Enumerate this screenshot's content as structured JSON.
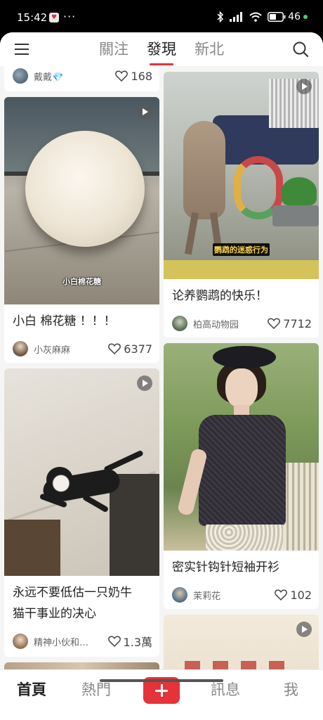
{
  "status_bar": {
    "time": "15:42",
    "dots": "···",
    "battery": "46",
    "app_badge": "♥"
  },
  "top_nav": {
    "tabs": [
      "關注",
      "發現",
      "新北"
    ],
    "active_tab": "發現"
  },
  "feed": {
    "left": [
      {
        "title": "",
        "author": "戴戴💎",
        "likes": "168"
      },
      {
        "title": "小白 棉花糖 ！！！",
        "image_caption": "小白棉花糖",
        "author": "小灰麻麻",
        "likes": "6377",
        "is_video": true
      },
      {
        "title_line1": "永远不要低估一只奶牛",
        "title_line2": "猫干事业的决心",
        "author": "精神小伙和…",
        "likes": "1.3萬",
        "is_video": true
      }
    ],
    "right": [
      {
        "title": "论养鹦鹉的快乐！",
        "image_caption": "鹦鹉的迷惑行为",
        "author": "柏高动物园",
        "likes": "7712",
        "is_video": true
      },
      {
        "title": "密实针钩针短袖开衫",
        "author": "茉莉花",
        "likes": "102"
      },
      {
        "title": "",
        "author": "",
        "likes": "",
        "is_video": true
      }
    ]
  },
  "bottom_nav": {
    "items": [
      "首頁",
      "熱門",
      "訊息",
      "我"
    ],
    "active": "首頁"
  },
  "colors": {
    "accent": "#e5333a",
    "background": "#f5f5f5",
    "text": "#222222",
    "muted": "#888888"
  },
  "icons": {
    "menu": "hamburger-icon",
    "search": "search-icon",
    "like": "heart-icon",
    "video": "play-icon",
    "create": "plus-icon"
  }
}
